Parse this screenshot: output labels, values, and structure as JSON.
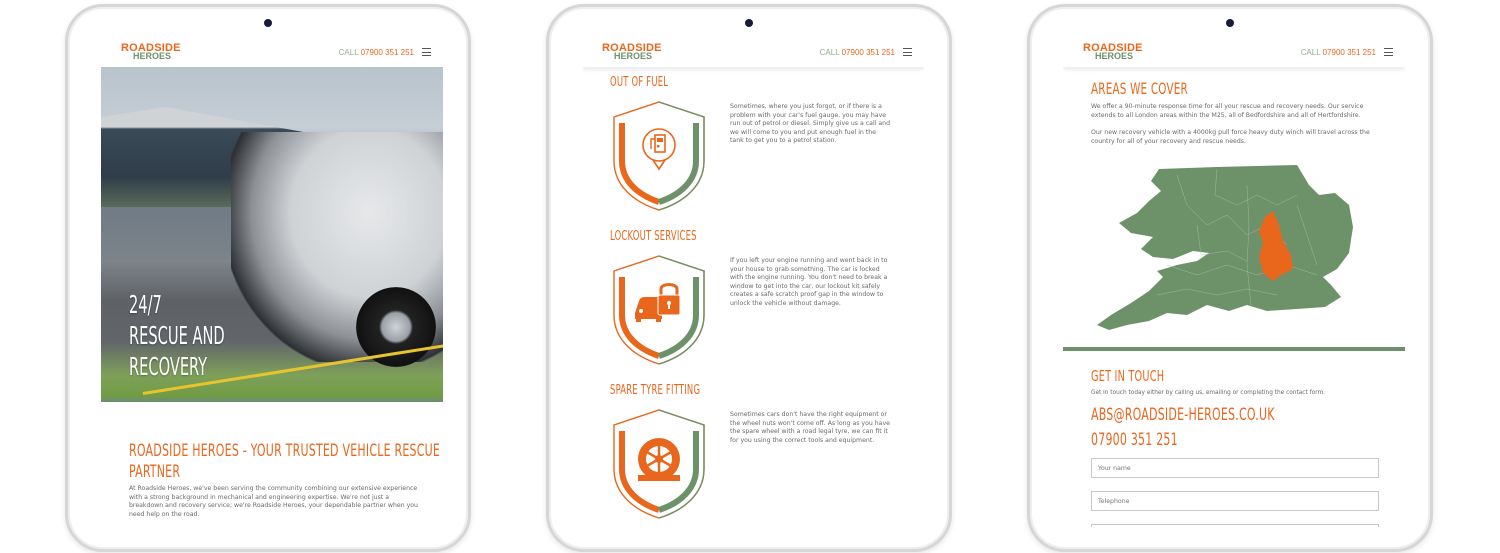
{
  "brand": {
    "logo_line1": "ROADSIDE",
    "logo_line2": "HEROES",
    "call_label": "CALL",
    "phone": "07900 351 251",
    "colors": {
      "orange": "#e8671d",
      "green": "#6d9269",
      "text": "#6a6a6a"
    }
  },
  "home": {
    "hero_line1": "24/7",
    "hero_line2": "RESCUE AND",
    "hero_line3": "RECOVERY",
    "title": "ROADSIDE HEROES - YOUR TRUSTED VEHICLE RESCUE PARTNER",
    "title_line1": "ROADSIDE HEROES - YOUR TRUSTED VEHICLE RESCUE",
    "title_line2": "PARTNER",
    "intro": "At Roadside Heroes, we've been serving the community combining our extensive experience with a strong background in mechanical and engineering expertise. We're not just a breakdown and recovery service; we're Roadside Heroes, your dependable partner when you need help on the road."
  },
  "services": [
    {
      "title": "OUT OF FUEL",
      "icon": "fuel-pump-icon",
      "text": "Sometimes, where you just forgot, or if there is a problem with your car's fuel gauge, you may have run out of petrol or diesel. Simply give us a call and we will come to you and put enough fuel in the tank to get you to a petrol station."
    },
    {
      "title": "LOCKOUT SERVICES",
      "icon": "car-lock-icon",
      "text": "If you left your engine running and went back in to your house to grab something. The car is locked with the engine running. You don't need to break a window to get into the car, our lockout kit safely creates a safe scratch proof gap in the window to unlock the vehicle without damage."
    },
    {
      "title": "SPARE TYRE FITTING",
      "icon": "tyre-icon",
      "text": "Sometimes cars don't have the right equipment or the wheel nuts won't come off. As long as you have the spare wheel with a road legal tyre, we can fit it for you using the correct tools and equipment."
    }
  ],
  "coverage": {
    "title": "AREAS WE COVER",
    "p1": "We offer a 90-minute response time for all your rescue and recovery needs. Our service extends to all London areas within the M25, all of Bedfordshire and all of Hertfordshire.",
    "p2": "Our new recovery vehicle with a 4000kg pull force heavy duty winch will travel across the country for all of your recovery and rescue needs."
  },
  "contact": {
    "title": "GET IN TOUCH",
    "text": "Get in touch today either by calling us, emailing or completing the contact form.",
    "email": "ABS@ROADSIDE-HEROES.CO.UK",
    "phone": "07900 351 251",
    "name_placeholder": "Your name",
    "telephone_placeholder": "Telephone"
  }
}
